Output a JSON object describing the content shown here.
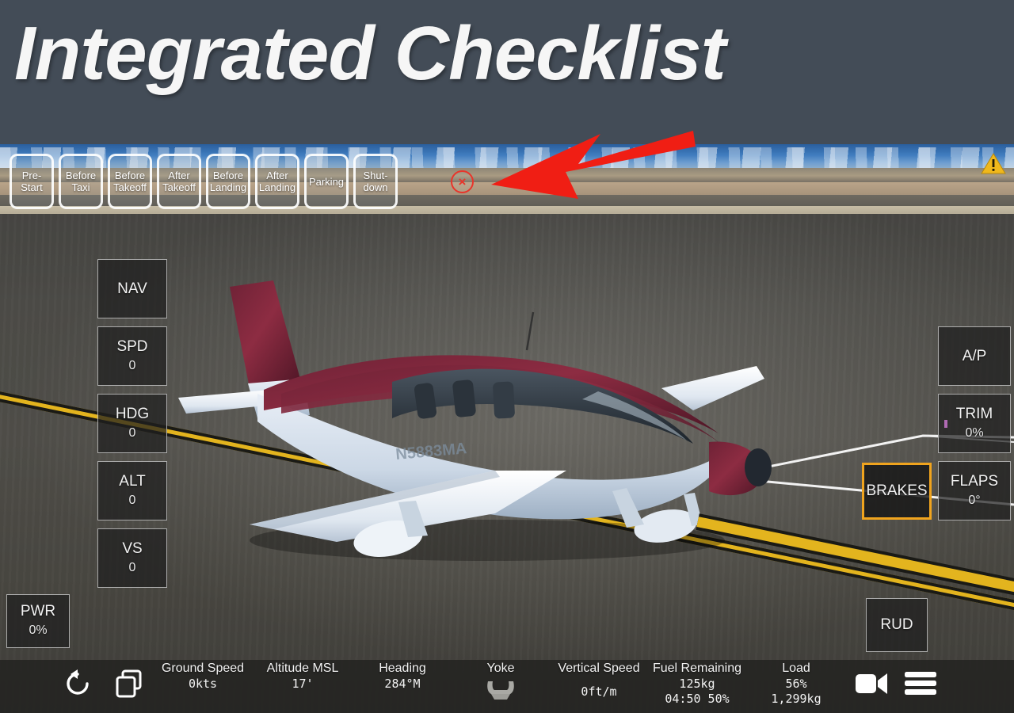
{
  "header": {
    "title": "Integrated Checklist",
    "background_color": "#434c57"
  },
  "checklist": {
    "close_label": "×",
    "tabs": [
      {
        "label": "Pre-\nStart",
        "line1": "Pre-",
        "line2": "Start"
      },
      {
        "label": "Before\nTaxi",
        "line1": "Before",
        "line2": "Taxi"
      },
      {
        "label": "Before\nTakeoff",
        "line1": "Before",
        "line2": "Takeoff"
      },
      {
        "label": "After\nTakeoff",
        "line1": "After",
        "line2": "Takeoff"
      },
      {
        "label": "Before\nLanding",
        "line1": "Before",
        "line2": "Landing"
      },
      {
        "label": "After\nLanding",
        "line1": "After",
        "line2": "Landing"
      },
      {
        "label": "Parking",
        "line1": "Parking",
        "line2": ""
      },
      {
        "label": "Shut-\ndown",
        "line1": "Shut-",
        "line2": "down"
      }
    ]
  },
  "annotation": {
    "arrow_color": "#f01e14",
    "points_to": "close-checklist-button"
  },
  "alert": {
    "icon": "warning-triangle-icon",
    "color": "#f0b81c"
  },
  "autopilot_left": {
    "buttons": [
      {
        "name": "NAV",
        "label": "NAV",
        "value": ""
      },
      {
        "name": "SPD",
        "label": "SPD",
        "value": "0"
      },
      {
        "name": "HDG",
        "label": "HDG",
        "value": "0"
      },
      {
        "name": "ALT",
        "label": "ALT",
        "value": "0"
      },
      {
        "name": "VS",
        "label": "VS",
        "value": "0"
      }
    ]
  },
  "controls_right": {
    "ap": {
      "label": "A/P",
      "value": ""
    },
    "trim": {
      "label": "TRIM",
      "value": "0%",
      "indicator_color": "#b06ab3"
    },
    "flaps": {
      "label": "FLAPS",
      "value": "0°"
    },
    "brakes": {
      "label": "BRAKES",
      "value": "",
      "highlight_color": "#f0a41e",
      "active": true
    },
    "rud": {
      "label": "RUD",
      "value": ""
    }
  },
  "power": {
    "label": "PWR",
    "value": "0%"
  },
  "statusbar": {
    "icons": {
      "reset": "reset-icon",
      "copy": "duplicate-icon",
      "camera": "camera-icon",
      "menu": "hamburger-menu-icon"
    },
    "readouts": [
      {
        "label": "Ground Speed",
        "value": "0kts",
        "value2": ""
      },
      {
        "label": "Altitude MSL",
        "value": "17'",
        "value2": ""
      },
      {
        "label": "Heading",
        "value": "284°M",
        "value2": ""
      },
      {
        "label": "Yoke",
        "value": "",
        "value2": "",
        "icon": "yoke-icon"
      },
      {
        "label": "Vertical Speed",
        "value": "0ft/m",
        "value2": ""
      },
      {
        "label": "Fuel Remaining",
        "value": "125kg",
        "value2": "04:50  50%"
      },
      {
        "label": "Load",
        "value": "56%",
        "value2": "1,299kg"
      }
    ]
  }
}
